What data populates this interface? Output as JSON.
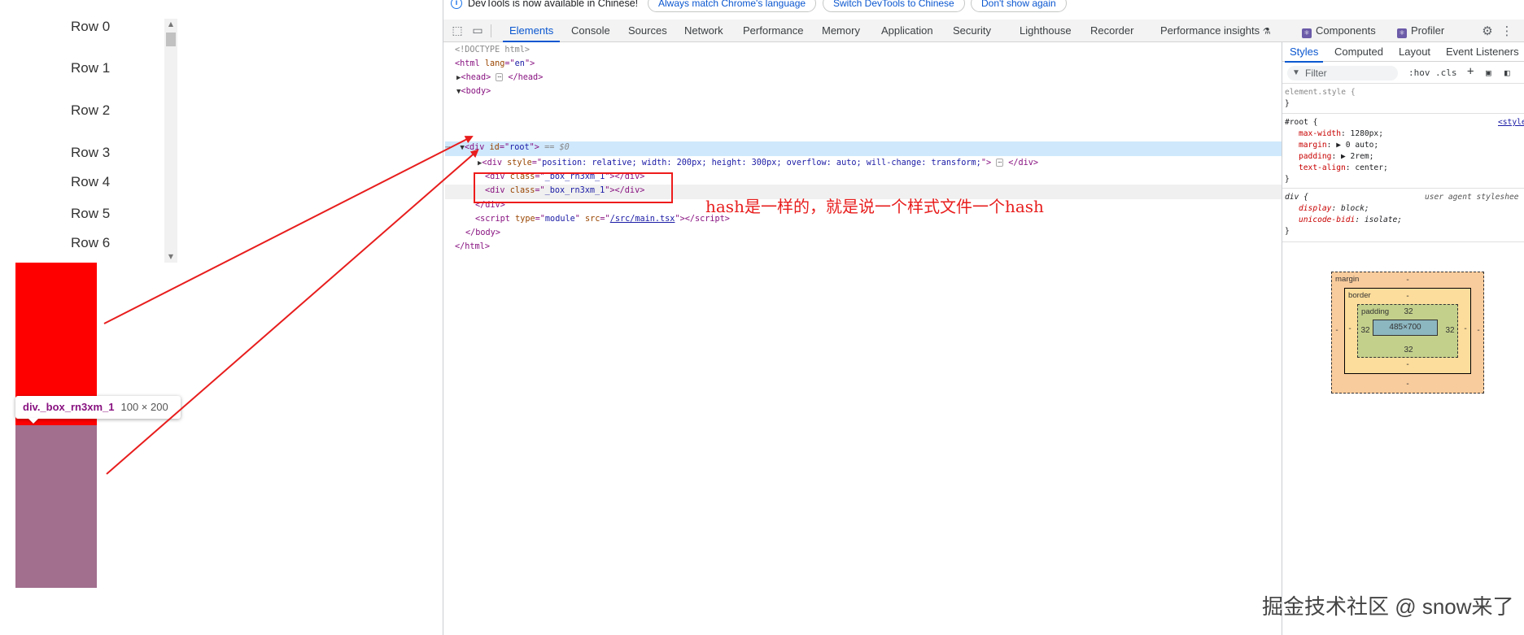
{
  "page": {
    "rows": [
      "Row 0",
      "Row 1",
      "Row 2",
      "Row 3",
      "Row 4",
      "Row 5",
      "Row 6"
    ],
    "tooltip": {
      "tag": "div._box_rn3xm_1",
      "size": "100 × 200"
    },
    "box_colors": {
      "red": "#ff0000",
      "purple": "#a26f8e"
    }
  },
  "infobar": {
    "message": "DevTools is now available in Chinese!",
    "buttons": [
      "Always match Chrome's language",
      "Switch DevTools to Chinese",
      "Don't show again"
    ]
  },
  "toolbar": {
    "tabs": [
      "Elements",
      "Console",
      "Sources",
      "Network",
      "Performance",
      "Memory",
      "Application",
      "Security",
      "Lighthouse",
      "Recorder",
      "Performance insights",
      "Components",
      "Profiler"
    ],
    "active_tab": "Elements"
  },
  "elements": {
    "doctype": "<!DOCTYPE html>",
    "html_open": {
      "tag": "html",
      "attr": "lang",
      "value": "en"
    },
    "head": "head",
    "body": "body",
    "root": {
      "tag": "div",
      "attr": "id",
      "value": "root",
      "selected_marker": "== $0"
    },
    "scroll_div": {
      "tag": "div",
      "attr": "style",
      "value": "position: relative; width: 200px; height: 300px; overflow: auto; will-change: transform;"
    },
    "box_divs": [
      {
        "tag": "div",
        "attr": "class",
        "value": "_box_rn3xm_1"
      },
      {
        "tag": "div",
        "attr": "class",
        "value": "_box_rn3xm_1"
      }
    ],
    "script": {
      "tag": "script",
      "attr1": "type",
      "val1": "module",
      "attr2": "src",
      "val2": "/src/main.tsx"
    },
    "annotation": "hash是一样的，就是说一个样式文件一个hash"
  },
  "styles": {
    "tabs": [
      "Styles",
      "Computed",
      "Layout",
      "Event Listeners"
    ],
    "active_tab": "Styles",
    "filter_placeholder": "Filter",
    "hov": ":hov",
    "cls": ".cls",
    "element_style": "element.style {",
    "root_rule": {
      "selector": "#root {",
      "origin": "<style",
      "props": [
        {
          "name": "max-width",
          "value": "1280px;"
        },
        {
          "name": "margin",
          "value": "▶ 0 auto;"
        },
        {
          "name": "padding",
          "value": "▶ 2rem;"
        },
        {
          "name": "text-align",
          "value": "center;"
        }
      ]
    },
    "div_rule": {
      "selector": "div {",
      "origin": "user agent styleshee",
      "props": [
        {
          "name": "display",
          "value": "block;"
        },
        {
          "name": "unicode-bidi",
          "value": "isolate;"
        }
      ]
    },
    "close_brace": "}",
    "box_model": {
      "margin_label": "margin",
      "border_label": "border",
      "padding_label": "padding",
      "margin": {
        "top": "-",
        "right": "-",
        "bottom": "-",
        "left": "-"
      },
      "border": {
        "top": "-",
        "right": "-",
        "bottom": "-",
        "left": "-"
      },
      "padding": {
        "top": "32",
        "right": "32",
        "bottom": "32",
        "left": "32"
      },
      "content": "485×700"
    }
  },
  "watermark": "掘金技术社区 @ snow来了"
}
